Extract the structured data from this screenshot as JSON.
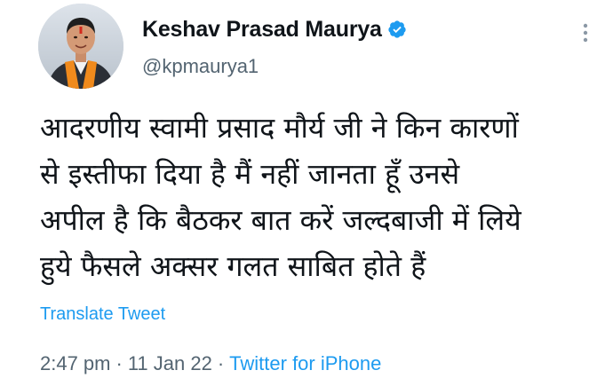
{
  "author": {
    "display_name": "Keshav Prasad Maurya",
    "handle": "@kpmaurya1",
    "verified": true
  },
  "tweet": {
    "text": "आदरणीय स्वामी प्रसाद मौर्य जी ने किन कारणों\nसे इस्तीफा दिया है मैं नहीं जानता हूँ उनसे\nअपील है कि बैठकर बात करें जल्दबाजी में लिये\nहुये फैसले अक्सर गलत साबित होते हैं",
    "translate_label": "Translate Tweet",
    "time": "2:47 pm",
    "separator": "·",
    "date": "11 Jan 22",
    "source": "Twitter for iPhone"
  },
  "icons": {
    "verified": "verified-badge-icon",
    "more": "more-options-icon",
    "avatar": "profile-photo"
  },
  "colors": {
    "accent": "#1d9bf0",
    "text_primary": "#0f1419",
    "text_secondary": "#536471"
  }
}
